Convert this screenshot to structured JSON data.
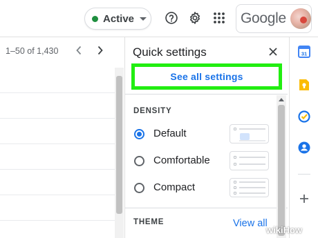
{
  "header": {
    "status_label": "Active",
    "status_color": "#1e8e3e",
    "help_icon": "help-circle-icon",
    "settings_icon": "gear-icon",
    "apps_icon": "apps-grid-icon",
    "brand_label": "Google"
  },
  "mail": {
    "pager_text": "1–50 of 1,430",
    "prev_icon": "chevron-left-icon",
    "next_icon": "chevron-right-icon"
  },
  "quick_settings": {
    "title": "Quick settings",
    "close_icon": "close-icon",
    "see_all_label": "See all settings",
    "highlight_color": "#22ee11",
    "density_heading": "DENSITY",
    "density_options": [
      {
        "label": "Default",
        "selected": true
      },
      {
        "label": "Comfortable",
        "selected": false
      },
      {
        "label": "Compact",
        "selected": false
      }
    ],
    "theme_heading": "THEME",
    "view_all_label": "View all"
  },
  "rail": {
    "icons": [
      "calendar-icon",
      "keep-icon",
      "tasks-icon",
      "contacts-icon",
      "add-icon"
    ],
    "calendar_day": "31"
  },
  "watermark": "wikiHow",
  "accent_color": "#1a73e8"
}
